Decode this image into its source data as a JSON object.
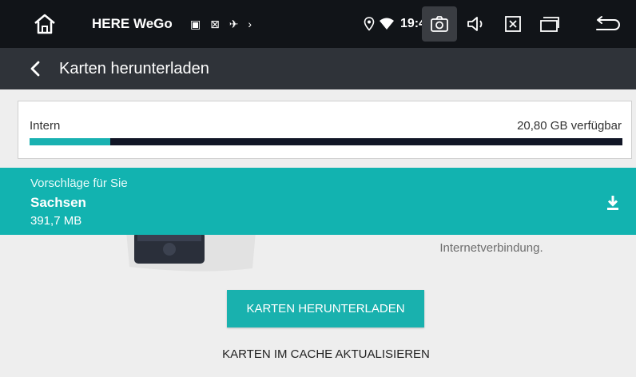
{
  "status_bar": {
    "app_name": "HERE WeGo",
    "notification_icons": "▣ ⊠ ✈ ›",
    "time": "19:48",
    "icons": [
      "home-icon",
      "location-icon",
      "wifi-icon",
      "screenshot-icon",
      "volume-icon",
      "close-app-icon",
      "recents-icon",
      "back-icon"
    ]
  },
  "toolbar": {
    "title": "Karten herunterladen"
  },
  "storage": {
    "label": "Intern",
    "available": "20,80 GB verfügbar",
    "used_fraction": 0.136
  },
  "background": {
    "description": "Internetverbindung."
  },
  "suggestion": {
    "heading": "Vorschläge für Sie",
    "region": "Sachsen",
    "size": "391,7 MB"
  },
  "actions": {
    "download_maps": "KARTEN HERUNTERLADEN",
    "update_cache": "KARTEN IM CACHE AKTUALISIEREN"
  },
  "colors": {
    "accent": "#12b3b0",
    "status_bar": "#111418",
    "toolbar": "#2f3339"
  }
}
